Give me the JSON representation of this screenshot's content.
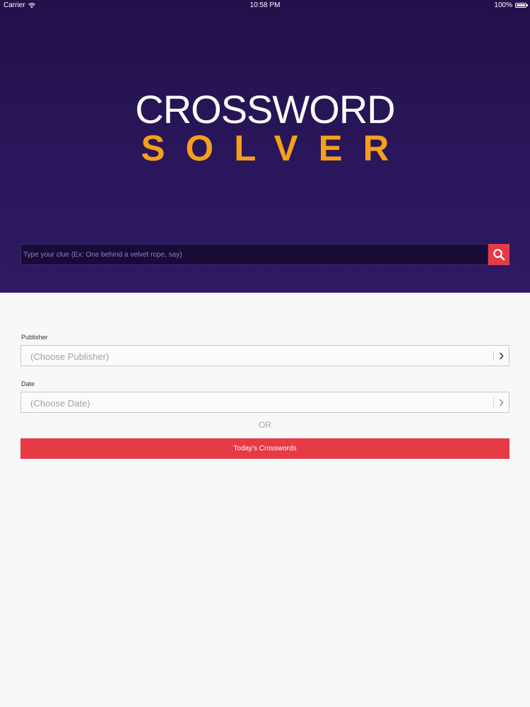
{
  "status_bar": {
    "carrier": "Carrier",
    "time": "10:58 PM",
    "battery": "100%"
  },
  "logo": {
    "line1": "CROSSWORD",
    "line2": "SOLVER"
  },
  "search": {
    "placeholder": "Type your clue (Ex: One behind a velvet rope, say)",
    "icon": "search-icon"
  },
  "publisher": {
    "label": "Publisher",
    "value": "(Choose Publisher)"
  },
  "date": {
    "label": "Date",
    "value": "(Choose Date)"
  },
  "or_text": "OR",
  "today_button": "Today's Crosswords",
  "colors": {
    "hero_bg": "#2a165b",
    "logo_accent": "#f5a01a",
    "action_red": "#e63a45",
    "page_bg": "#f8f8f9"
  }
}
